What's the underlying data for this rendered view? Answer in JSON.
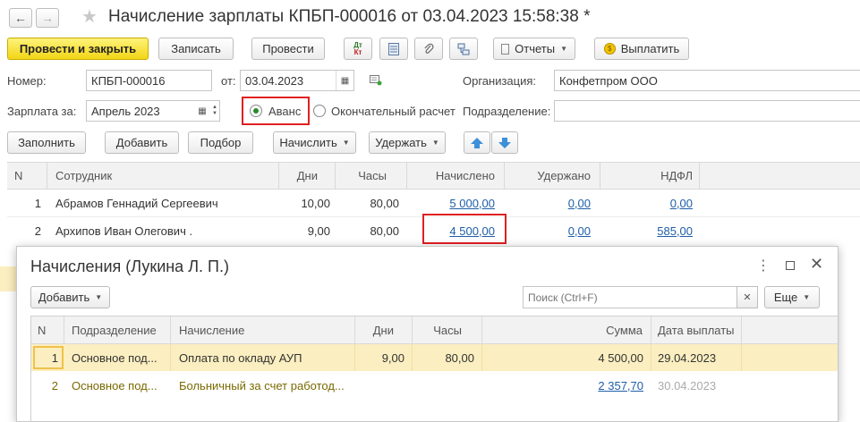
{
  "window": {
    "title": "Начисление зарплаты КПБП-000016 от 03.04.2023 15:58:38 *"
  },
  "toolbar": {
    "post_close": "Провести и закрыть",
    "save": "Записать",
    "post": "Провести",
    "dt_kt_top": "Дт",
    "dt_kt_bottom": "Кт",
    "reports": "Отчеты",
    "pay": "Выплатить"
  },
  "form": {
    "number_label": "Номер:",
    "number_value": "КПБП-000016",
    "date_label": "от:",
    "date_value": "03.04.2023",
    "org_label": "Организация:",
    "org_value": "Конфетпром ООО",
    "salary_for_label": "Зарплата за:",
    "salary_for_value": "Апрель 2023",
    "radio_advance": "Аванс",
    "radio_final": "Окончательный расчет",
    "division_label": "Подразделение:",
    "division_value": ""
  },
  "actions": {
    "fill": "Заполнить",
    "add": "Добавить",
    "pick": "Подбор",
    "accrue": "Начислить",
    "withhold": "Удержать"
  },
  "main_table": {
    "headers": [
      "N",
      "Сотрудник",
      "Дни",
      "Часы",
      "Начислено",
      "Удержано",
      "НДФЛ"
    ],
    "rows": [
      {
        "n": "1",
        "employee": "Абрамов Геннадий Сергеевич",
        "days": "10,00",
        "hours": "80,00",
        "accrued": "5 000,00",
        "withheld": "0,00",
        "ndfl": "0,00"
      },
      {
        "n": "2",
        "employee": "Архипов Иван Олегович .",
        "days": "9,00",
        "hours": "80,00",
        "accrued": "4 500,00",
        "withheld": "0,00",
        "ndfl": "585,00"
      }
    ]
  },
  "dialog": {
    "title": "Начисления (Лукина Л. П.)",
    "add": "Добавить",
    "search_placeholder": "Поиск (Ctrl+F)",
    "more": "Еще",
    "headers": [
      "N",
      "Подразделение",
      "Начисление",
      "Дни",
      "Часы",
      "Сумма",
      "Дата выплаты"
    ],
    "rows": [
      {
        "n": "1",
        "division": "Основное под...",
        "accrual": "Оплата по окладу АУП",
        "days": "9,00",
        "hours": "80,00",
        "sum": "4 500,00",
        "pay_date": "29.04.2023"
      },
      {
        "n": "2",
        "division": "Основное под...",
        "accrual": "Больничный за счет работод...",
        "days": "",
        "hours": "",
        "sum": "2 357,70",
        "pay_date": "30.04.2023"
      }
    ]
  },
  "colors": {
    "primary_button": "#f2d516",
    "selected_row": "#fbeec0",
    "link": "#1f5ea8",
    "highlight_box": "#e02020",
    "arrow_buttons": "#3d8fd8"
  }
}
